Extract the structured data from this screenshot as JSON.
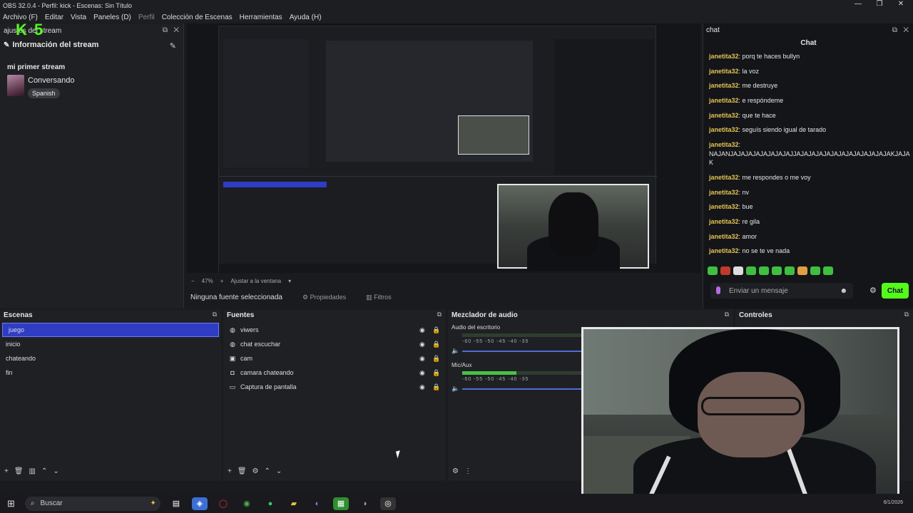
{
  "window": {
    "title": "OBS 32.0.4 - Perfil: kick - Escenas: Sin Título",
    "controls": [
      "—",
      "❐",
      "✕"
    ]
  },
  "menu": [
    {
      "label": "Archivo (F)",
      "dim": false
    },
    {
      "label": "Editar",
      "dim": false
    },
    {
      "label": "Vista",
      "dim": false
    },
    {
      "label": "Paneles (D)",
      "dim": false
    },
    {
      "label": "Perfil",
      "dim": true
    },
    {
      "label": "Colección de Escenas",
      "dim": false
    },
    {
      "label": "Herramientas",
      "dim": false
    },
    {
      "label": "Ayuda (H)",
      "dim": false
    }
  ],
  "left_dock": {
    "title": "ajustes del stream",
    "logo": "K 5",
    "info_label": "Información del stream",
    "stream_title": "mi primer stream",
    "category": "Conversando",
    "language": "Spanish"
  },
  "preview": {
    "zoom": "47%",
    "fit_label": "Ajustar a la ventana",
    "no_source": "Ninguna fuente seleccionada",
    "properties": "Propiedades",
    "filters": "Filtros"
  },
  "chat": {
    "dock_title": "chat",
    "heading": "Chat",
    "messages": [
      {
        "user": "janetita32",
        "text": "porq te haces bullyn"
      },
      {
        "user": "janetita32",
        "text": "la voz"
      },
      {
        "user": "janetita32",
        "text": "me destruye"
      },
      {
        "user": "janetita32",
        "text": "e respóndeme"
      },
      {
        "user": "janetita32",
        "text": "que te hace"
      },
      {
        "user": "janetita32",
        "text": "seguís siendo igual de tarado"
      },
      {
        "user": "janetita32",
        "text": "NAJANJAJAJAJAJAJAJAJAJJAJAJAJAJAJAJAJAJAJAJAJAJAKJAJAK"
      },
      {
        "user": "janetita32",
        "text": "me respondes o me voy"
      },
      {
        "user": "janetita32",
        "text": "nv"
      },
      {
        "user": "janetita32",
        "text": "bue"
      },
      {
        "user": "janetita32",
        "text": "re gila"
      },
      {
        "user": "janetita32",
        "text": "amor"
      },
      {
        "user": "janetita32",
        "text": "no se te ve nada"
      }
    ],
    "input_placeholder": "Enviar un mensaje",
    "send_label": "Chat",
    "accent": "#53fc18",
    "username_color": "#e2c44a"
  },
  "scenes": {
    "title": "Escenas",
    "items": [
      "juego",
      "inicio",
      "chateando",
      "fin"
    ],
    "selected": "juego"
  },
  "sources": {
    "title": "Fuentes",
    "items": [
      {
        "name": "viwers",
        "icon": "browser-icon"
      },
      {
        "name": "chat escuchar",
        "icon": "browser-icon"
      },
      {
        "name": "cam",
        "icon": "image-icon"
      },
      {
        "name": "camara chateando",
        "icon": "camera-icon"
      },
      {
        "name": "Captura de pantalla",
        "icon": "monitor-icon"
      }
    ]
  },
  "mixer": {
    "title": "Mezclador de audio",
    "channels": [
      {
        "name": "Audio del escritorio",
        "level_fraction": 0.0
      },
      {
        "name": "Mic/Aux",
        "level_fraction": 0.4
      }
    ],
    "ticks": "-60  -55  -50  -45  -40  -35"
  },
  "controls": {
    "title": "Controles"
  },
  "taskbar": {
    "search_label": "Buscar",
    "clock": "6/1/2026"
  }
}
